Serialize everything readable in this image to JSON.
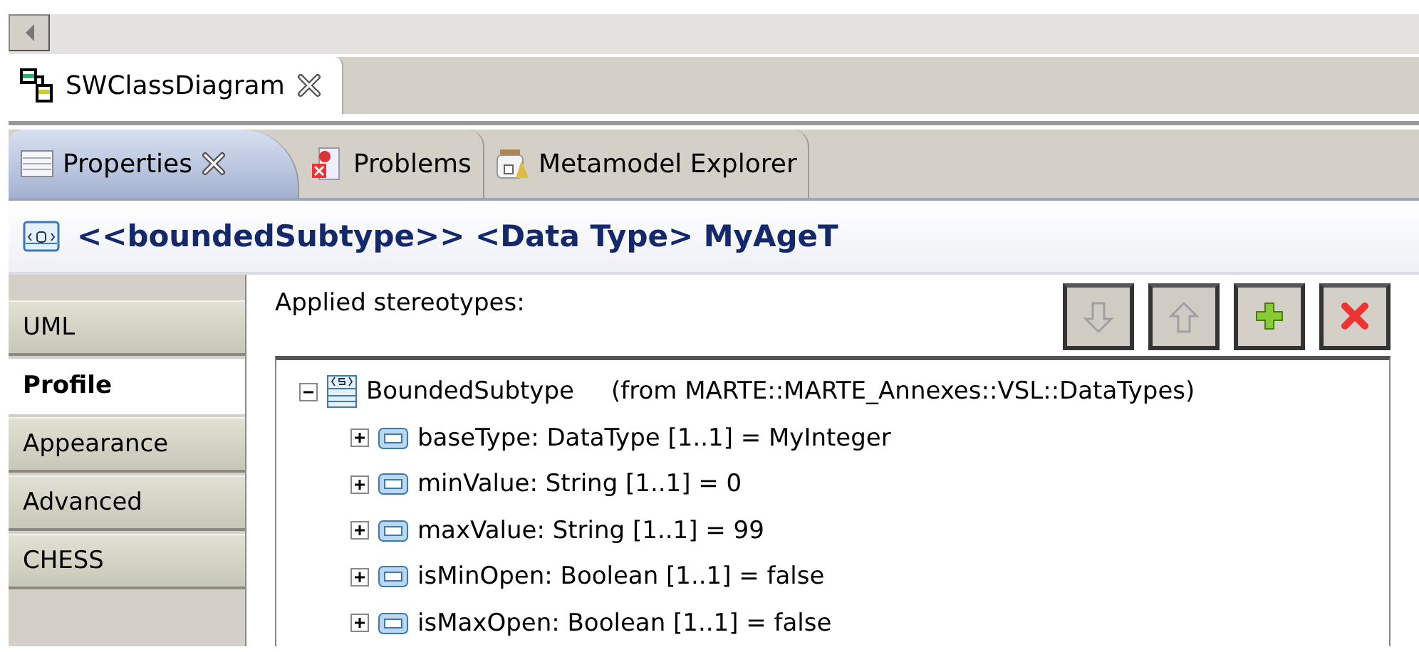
{
  "editor_tabs": [
    {
      "label": "SWClassDiagram",
      "selected": true,
      "closable": true
    }
  ],
  "view_tabs": [
    {
      "label": "Properties",
      "kind": "properties",
      "selected": true,
      "closable": true
    },
    {
      "label": "Problems",
      "kind": "problems",
      "selected": false,
      "closable": false
    },
    {
      "label": "Metamodel Explorer",
      "kind": "explorer",
      "selected": false,
      "closable": false
    }
  ],
  "header": {
    "title": "<<boundedSubtype>> <Data Type> MyAgeT"
  },
  "sidebar": {
    "items": [
      {
        "label": "UML",
        "selected": false
      },
      {
        "label": "Profile",
        "selected": true
      },
      {
        "label": "Appearance",
        "selected": false
      },
      {
        "label": "Advanced",
        "selected": false
      },
      {
        "label": "CHESS",
        "selected": false
      }
    ]
  },
  "stereotypes": {
    "label": "Applied stereotypes:",
    "buttons": [
      {
        "kind": "down",
        "disabled": true
      },
      {
        "kind": "up",
        "disabled": true
      },
      {
        "kind": "add",
        "disabled": false
      },
      {
        "kind": "remove",
        "disabled": false
      }
    ],
    "tree": [
      {
        "label": "BoundedSubtype",
        "source": "(from MARTE::MARTE_Annexes::VSL::DataTypes)",
        "kind": "stereotype",
        "expanded": true,
        "children": [
          {
            "label": "baseType: DataType [1..1] = MyInteger",
            "kind": "property",
            "expanded": false
          },
          {
            "label": "minValue: String [1..1] = 0",
            "kind": "property",
            "expanded": false
          },
          {
            "label": "maxValue: String [1..1] = 99",
            "kind": "property",
            "expanded": false
          },
          {
            "label": "isMinOpen: Boolean [1..1] = false",
            "kind": "property",
            "expanded": false
          },
          {
            "label": "isMaxOpen: Boolean [1..1] = false",
            "kind": "property",
            "expanded": false
          }
        ]
      }
    ]
  }
}
